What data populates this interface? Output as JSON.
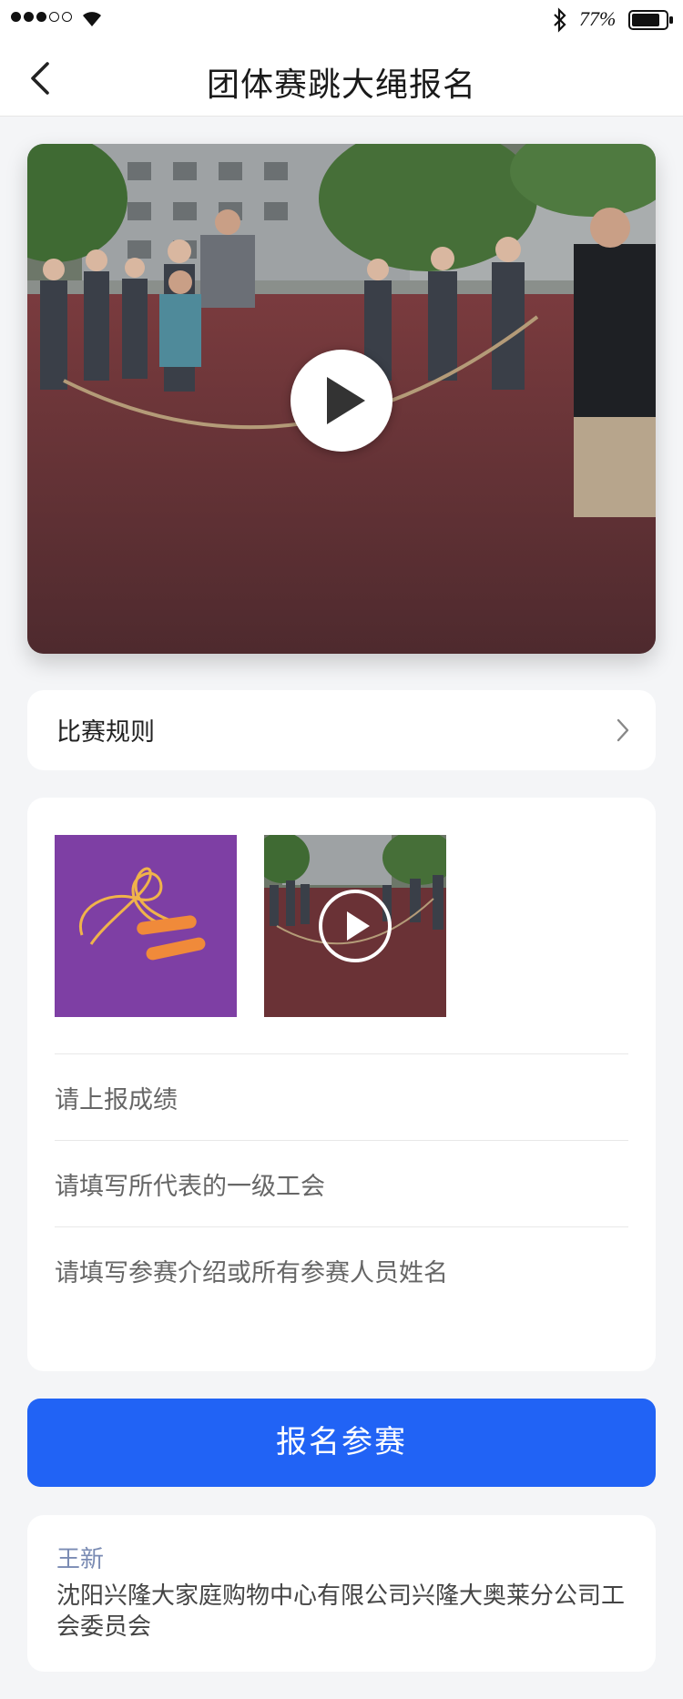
{
  "status_bar": {
    "battery_percent": "77%",
    "signal_bars_filled": 3,
    "signal_bars_total": 5
  },
  "nav": {
    "title": "团体赛跳大绳报名",
    "back_icon": "chevron-left-icon"
  },
  "hero_video": {
    "play_icon": "play-icon"
  },
  "rules": {
    "label": "比赛规则",
    "arrow_icon": "chevron-right-icon"
  },
  "form": {
    "media": [
      {
        "type": "image",
        "icon": "jump-rope-image"
      },
      {
        "type": "video",
        "icon": "play-icon"
      }
    ],
    "score_placeholder": "请上报成绩",
    "union_placeholder": "请填写所代表的一级工会",
    "members_placeholder": "请填写参赛介绍或所有参赛人员姓名"
  },
  "submit": {
    "label": "报名参赛"
  },
  "organizer": {
    "name": "王新",
    "description": "沈阳兴隆大家庭购物中心有限公司兴隆大奥莱分公司工会委员会"
  },
  "colors": {
    "primary": "#2163f5",
    "organizer_name": "#7a8bb3",
    "background": "#f4f5f7"
  }
}
